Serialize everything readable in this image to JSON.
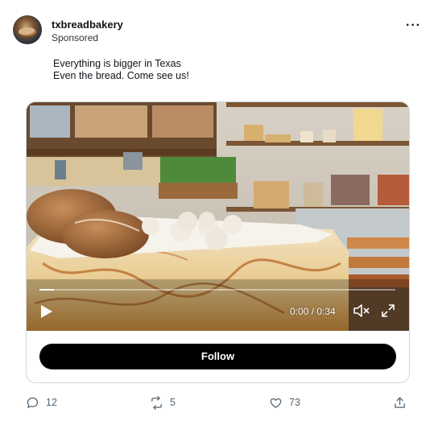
{
  "post": {
    "username": "txbreadbakery",
    "sponsored_label": "Sponsored",
    "caption_lines": [
      "Everything is bigger in Texas",
      "Even the bread. Come see us!"
    ]
  },
  "video": {
    "time_display": "0:00 / 0:34",
    "progress_fraction": 0.04,
    "controls": [
      "play-icon",
      "mute-icon",
      "expand-icon"
    ]
  },
  "cta": {
    "label": "Follow"
  },
  "engagement": {
    "replies": "12",
    "reposts": "5",
    "likes": "73"
  },
  "icons": [
    "more-options-icon",
    "reply-icon",
    "repost-icon",
    "like-icon",
    "share-icon"
  ],
  "colors": {
    "text": "#0f1419",
    "muted": "#536471",
    "button": "#000000",
    "border": "#cfd9de"
  }
}
